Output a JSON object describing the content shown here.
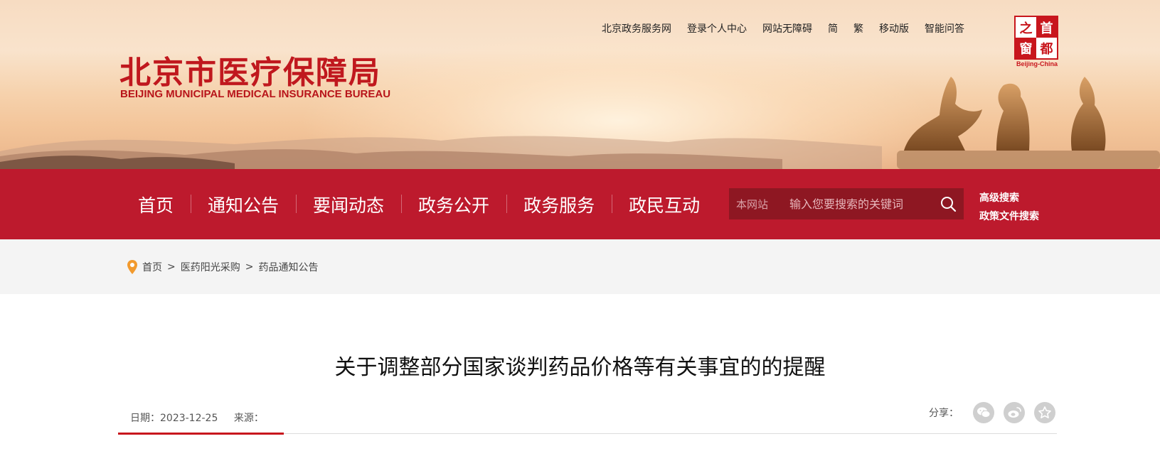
{
  "header": {
    "title_cn": "北京市医疗保障局",
    "title_en": "BEIJING MUNICIPAL MEDICAL INSURANCE BUREAU",
    "top_links": [
      "北京政务服务网",
      "登录个人中心",
      "网站无障碍",
      "简",
      "繁",
      "移动版",
      "智能问答"
    ],
    "capital_logo": {
      "chars": [
        "之",
        "首",
        "窗",
        "都"
      ],
      "caption": "Beijing-China"
    }
  },
  "nav": {
    "items": [
      "首页",
      "通知公告",
      "要闻动态",
      "政务公开",
      "政务服务",
      "政民互动"
    ]
  },
  "search": {
    "scope": "本网站",
    "placeholder": "输入您要搜索的关键词",
    "icon": "search-icon",
    "advanced_links": [
      "高级搜索",
      "政策文件搜索"
    ]
  },
  "breadcrumb": {
    "icon": "location-pin-icon",
    "items": [
      "首页",
      "医药阳光采购",
      "药品通知公告"
    ],
    "separator": ">"
  },
  "article": {
    "title": "关于调整部分国家谈判药品价格等有关事宜的的提醒",
    "date_label": "日期：2023-12-25",
    "source_label": "来源：",
    "share_label": "分享：",
    "share_icons": [
      "wechat-icon",
      "weibo-icon",
      "favorite-icon"
    ]
  },
  "colors": {
    "brand_red": "#bd1a2d",
    "search_bg": "#8e1722",
    "accent_line": "#c8161d",
    "breadcrumb_bg": "#f4f4f4"
  }
}
